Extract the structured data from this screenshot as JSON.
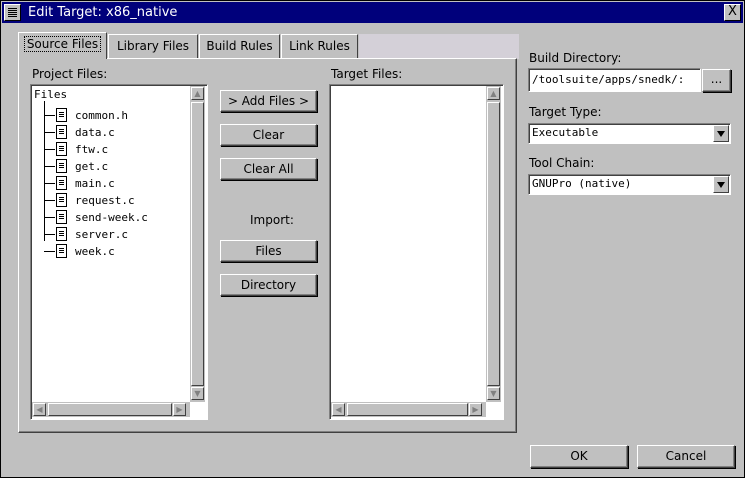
{
  "window": {
    "title": "Edit Target: x86_native",
    "close_glyph": "X"
  },
  "tabs": [
    {
      "label": "Source Files",
      "active": true
    },
    {
      "label": "Library Files",
      "active": false
    },
    {
      "label": "Build Rules",
      "active": false
    },
    {
      "label": "Link Rules",
      "active": false
    }
  ],
  "project_files": {
    "label": "Project Files:",
    "root": "Files",
    "items": [
      "common.h",
      "data.c",
      "ftw.c",
      "get.c",
      "main.c",
      "request.c",
      "send-week.c",
      "server.c",
      "week.c"
    ]
  },
  "target_files": {
    "label": "Target Files:",
    "items": []
  },
  "actions": {
    "add_files": "> Add Files >",
    "clear": "Clear",
    "clear_all": "Clear All",
    "import_label": "Import:",
    "files": "Files",
    "directory": "Directory"
  },
  "build_directory": {
    "label": "Build Directory:",
    "value": "/toolsuite/apps/snedk/:",
    "browse": "..."
  },
  "target_type": {
    "label": "Target Type:",
    "value": "Executable"
  },
  "tool_chain": {
    "label": "Tool Chain:",
    "value": "GNUPro (native)"
  },
  "footer": {
    "ok": "OK",
    "cancel": "Cancel"
  }
}
